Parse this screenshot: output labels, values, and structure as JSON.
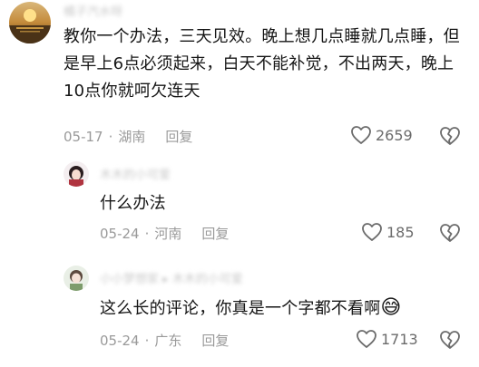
{
  "comments": [
    {
      "username": "橘子汽水呀",
      "text": "教你一个办法，三天见效。晚上想几点睡就几点睡，但是早上6点必须起来，白天不能补觉，不出两天，晚上10点你就呵欠连天",
      "date": "05-17",
      "location": "湖南",
      "reply_label": "回复",
      "likes": "2659"
    },
    {
      "username": "木木的小可爱",
      "text": "什么办法",
      "date": "05-24",
      "location": "河南",
      "reply_label": "回复",
      "likes": "185"
    },
    {
      "username": "小小梦想家 ▸ 木木的小可爱",
      "text": "这么长的评论，你真是一个字都不看啊",
      "emoji": "😅",
      "date": "05-24",
      "location": "广东",
      "reply_label": "回复",
      "likes": "1713"
    }
  ],
  "separator": "·",
  "icons": {
    "like": "heart-outline-icon",
    "dislike": "broken-heart-icon",
    "like_color": "#6b6b6b"
  }
}
